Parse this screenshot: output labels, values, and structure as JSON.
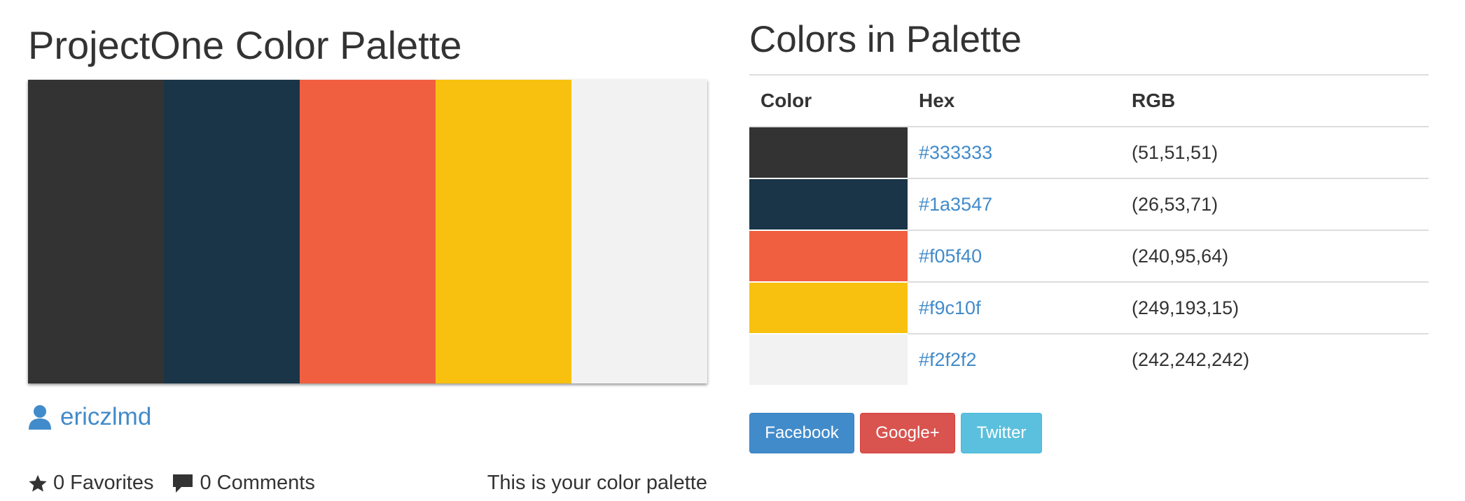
{
  "palette": {
    "title": "ProjectOne Color Palette",
    "colors": [
      {
        "hex": "#333333",
        "rgb": "(51,51,51)"
      },
      {
        "hex": "#1a3547",
        "rgb": "(26,53,71)"
      },
      {
        "hex": "#f05f40",
        "rgb": "(240,95,64)"
      },
      {
        "hex": "#f9c10f",
        "rgb": "(249,193,15)"
      },
      {
        "hex": "#f2f2f2",
        "rgb": "(242,242,242)"
      }
    ],
    "author": "ericzlmd",
    "favorites": "0 Favorites",
    "comments": "0 Comments",
    "caption": "This is your color palette"
  },
  "table": {
    "heading": "Colors in Palette",
    "headers": {
      "color": "Color",
      "hex": "Hex",
      "rgb": "RGB"
    }
  },
  "share": {
    "facebook": "Facebook",
    "google": "Google+",
    "twitter": "Twitter"
  },
  "icons": {
    "user": "user-icon",
    "favorites": "star-icon",
    "comments": "comment-icon"
  },
  "theme": {
    "link": "#428bca",
    "facebook": "#428bca",
    "google": "#d9534f",
    "twitter": "#5bc0de"
  }
}
